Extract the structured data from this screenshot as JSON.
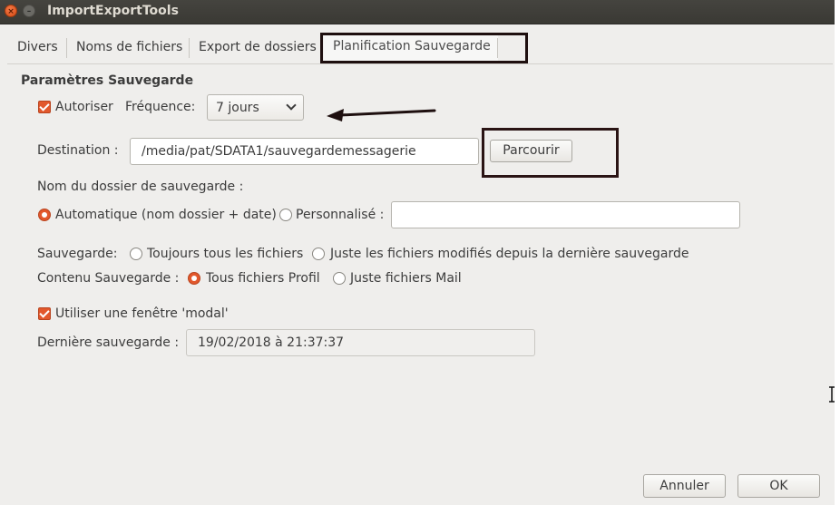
{
  "window": {
    "title": "ImportExportTools",
    "close_glyph": "×",
    "min_glyph": "–"
  },
  "tabs": [
    {
      "label": "Divers",
      "active": false
    },
    {
      "label": "Noms de fichiers",
      "active": false
    },
    {
      "label": "Export de dossiers",
      "active": false
    },
    {
      "label": "Planification Sauvegarde",
      "active": true
    }
  ],
  "section_title": "Paramètres Sauvegarde",
  "enable": {
    "label": "Autoriser",
    "checked": true
  },
  "frequency": {
    "label": "Fréquence:",
    "value": "7 jours"
  },
  "destination": {
    "label": "Destination :",
    "value": "/media/pat/SDATA1/sauvegardemessagerie",
    "browse_label": "Parcourir"
  },
  "folder_name": {
    "label": "Nom du dossier de sauvegarde :",
    "auto_label": "Automatique (nom dossier + date)",
    "custom_label": "Personnalisé :",
    "custom_value": "",
    "selected": "auto"
  },
  "backup_mode": {
    "label": "Sauvegarde:",
    "all_label": "Toujours tous les fichiers",
    "modified_label": "Juste les fichiers modifiés depuis la dernière sauvegarde",
    "selected": "none"
  },
  "backup_content": {
    "label": "Contenu Sauvegarde :",
    "profile_label": "Tous fichiers Profil",
    "mail_label": "Juste fichiers Mail",
    "selected": "profile"
  },
  "modal": {
    "label": "Utiliser une fenêtre 'modal'",
    "checked": true
  },
  "last_backup": {
    "label": "Dernière sauvegarde :",
    "value": "19/02/2018 à 21:37:37"
  },
  "buttons": {
    "cancel": "Annuler",
    "ok": "OK"
  },
  "colors": {
    "accent": "#e2582c",
    "annotation": "#1e0f0f",
    "titlebar": "#3c3b37"
  }
}
